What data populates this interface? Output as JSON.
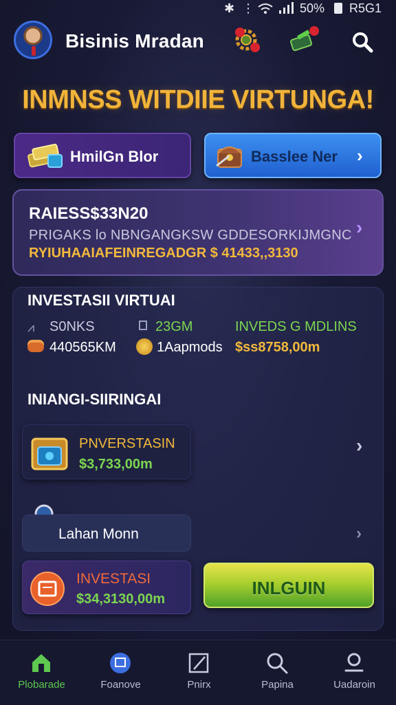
{
  "status_bar": {
    "battery": "50%",
    "carrier": "R5G1"
  },
  "header": {
    "title": "Bisinis Mradan"
  },
  "banner": {
    "text": "INMNSS WITDIIE VIRTUNGA!"
  },
  "actions": {
    "left_label": "HmilGn Blor",
    "right_label": "Basslee Ner"
  },
  "balance_card": {
    "line1": "RAIESS$33N20",
    "line2": "PRIGAKS lo NBNGANGKSW GDDESORKIJMGNC",
    "line3": "RYIUHAAIAFEINREGADGR $ 41433,,3130"
  },
  "investment": {
    "title": "INVESTASII VIRTUAI",
    "stats": [
      {
        "label": "S0NKS",
        "color": "#c9cbe0"
      },
      {
        "label": "23GM",
        "color": "#7cd650"
      },
      {
        "label": "INVEDS G MDLINS",
        "color": "#7cd650"
      },
      {
        "label": "440565KM",
        "color": "#ffffff"
      },
      {
        "label": "1Aapmods",
        "color": "#ffffff"
      },
      {
        "label": "$ss8758,00m",
        "color": "#f3b93c"
      }
    ]
  },
  "portfolio": {
    "title": "INIANGI-SIIRINGAI",
    "tile1": {
      "name": "PNVERSTASIN",
      "value": "$3,733,00m"
    },
    "tile2": {
      "name": "Lahan Monn"
    },
    "tile3": {
      "name": "INVESTASI",
      "value": "$34,3130,00m"
    },
    "login_label": "INLGUIN"
  },
  "bottom_nav": [
    {
      "label": "Plobarade",
      "icon": "home-icon"
    },
    {
      "label": "Foanove",
      "icon": "shield-icon"
    },
    {
      "label": "Pnirx",
      "icon": "edit-icon"
    },
    {
      "label": "Papina",
      "icon": "search-icon"
    },
    {
      "label": "Uadaroin",
      "icon": "profile-icon"
    }
  ],
  "colors": {
    "accent_gold": "#f1b43a",
    "accent_green": "#7cd650",
    "nav_active": "#5ec850"
  }
}
